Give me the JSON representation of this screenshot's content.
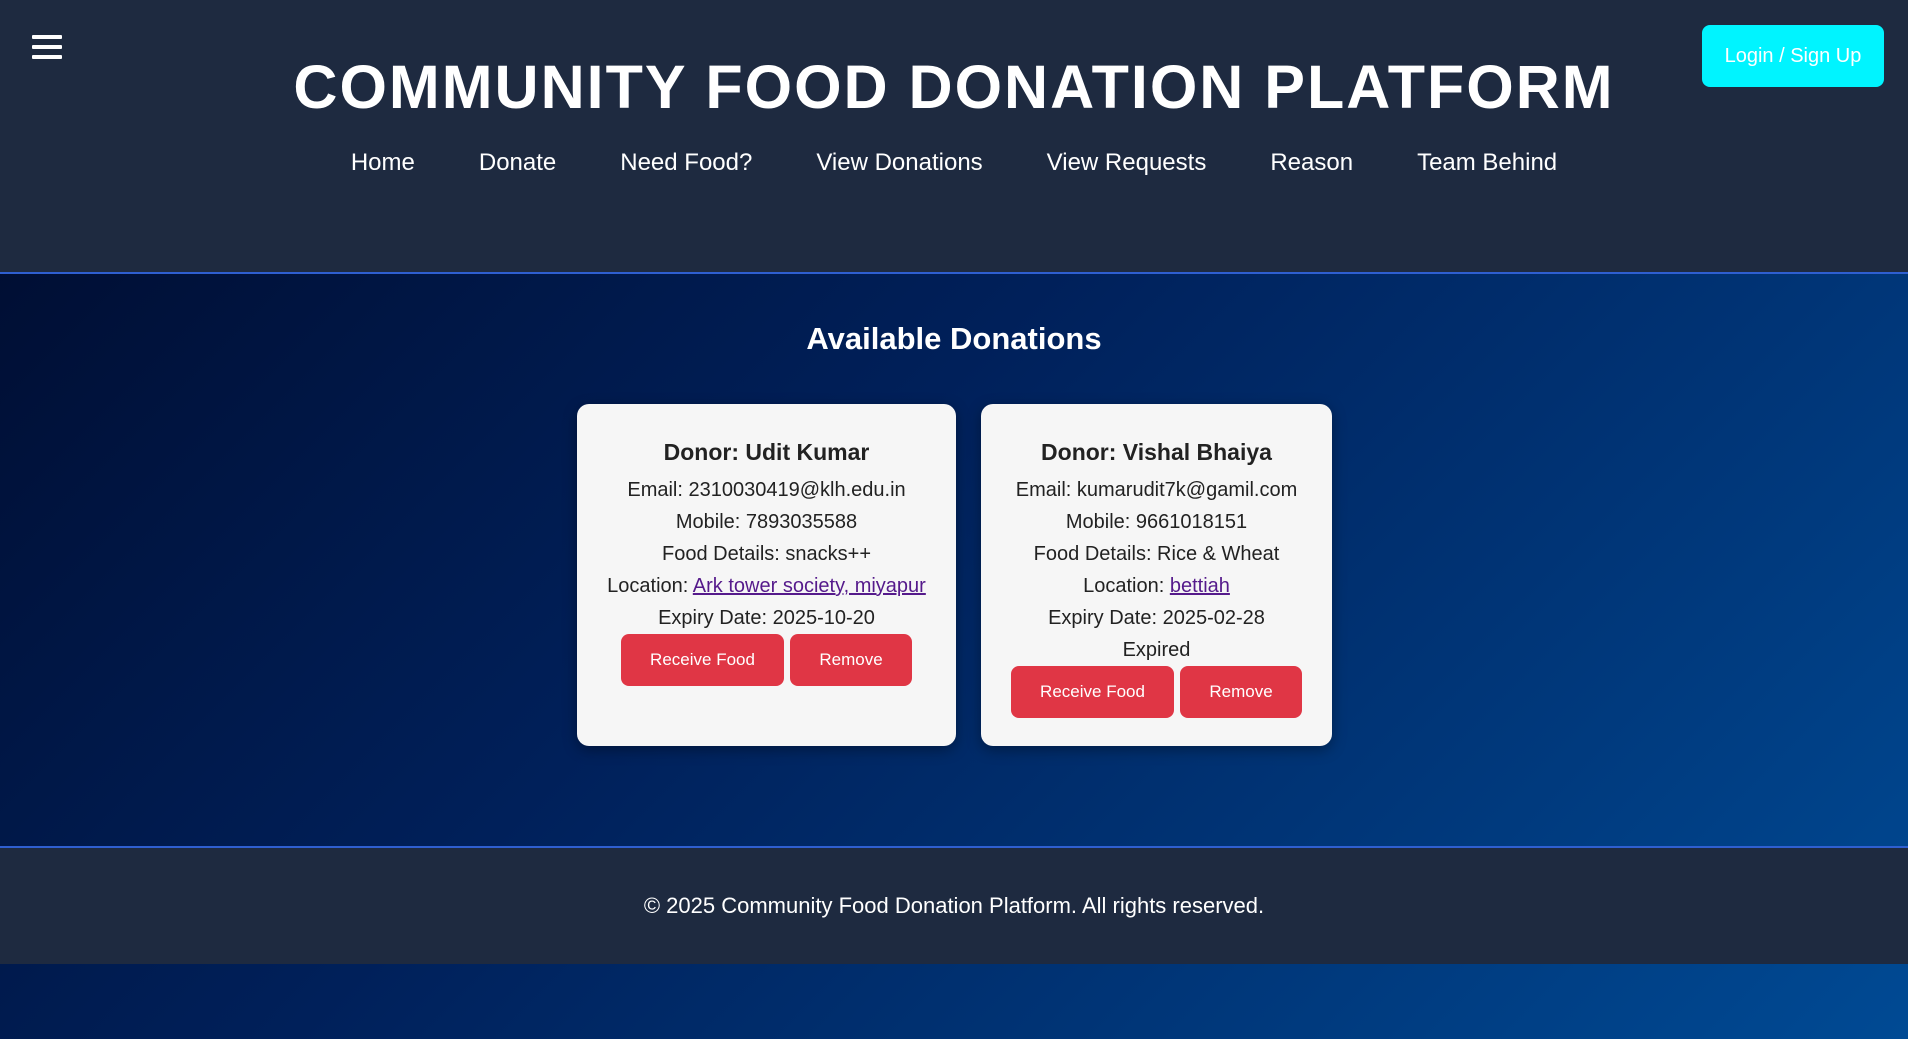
{
  "header": {
    "menu_icon": "hamburger-menu-icon",
    "title": "COMMUNITY FOOD DONATION PLATFORM",
    "login_label": "Login / Sign Up",
    "nav": [
      "Home",
      "Donate",
      "Need Food?",
      "View Donations",
      "View Requests",
      "Reason",
      "Team Behind"
    ]
  },
  "main": {
    "section_title": "Available Donations",
    "cards": [
      {
        "donor": "Donor: Udit Kumar",
        "email": "Email: 2310030419@klh.edu.in",
        "mobile": "Mobile: 7893035588",
        "food": "Food Details: snacks++",
        "location_label": "Location: ",
        "location_link": "Ark tower society, miyapur",
        "expiry": "Expiry Date: 2025-10-20",
        "status": "",
        "receive_label": "Receive Food",
        "remove_label": "Remove"
      },
      {
        "donor": "Donor: Vishal Bhaiya",
        "email": "Email: kumarudit7k@gamil.com",
        "mobile": "Mobile: 9661018151",
        "food": "Food Details: Rice & Wheat",
        "location_label": "Location: ",
        "location_link": "bettiah",
        "expiry": "Expiry Date: 2025-02-28",
        "status": "Expired",
        "receive_label": "Receive Food",
        "remove_label": "Remove"
      }
    ]
  },
  "footer": {
    "text": "© 2025 Community Food Donation Platform. All rights reserved."
  },
  "colors": {
    "header_bg": "#1e2a40",
    "accent_cyan": "#00f4ff",
    "button_red": "#e03645",
    "link_purple": "#551a8b",
    "border_blue": "#2f5fd0"
  }
}
